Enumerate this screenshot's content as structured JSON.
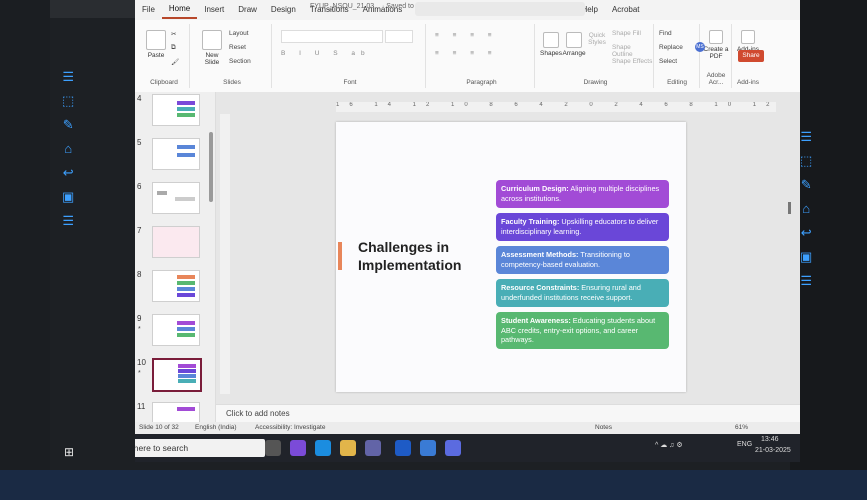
{
  "window": {
    "title": "FYUP_NSOU_21.03...",
    "save_status": "Saved to this PC"
  },
  "ribbon_tabs": [
    "File",
    "Home",
    "Insert",
    "Draw",
    "Design",
    "Transitions",
    "Animations",
    "Slide Show",
    "Record",
    "Review",
    "View",
    "Help",
    "Acrobat"
  ],
  "ribbon": {
    "clipboard": {
      "paste": "Paste",
      "label": "Clipboard"
    },
    "slides": {
      "new_slide": "New Slide",
      "layout": "Layout",
      "reset": "Reset",
      "section": "Section",
      "label": "Slides"
    },
    "font": {
      "label": "Font"
    },
    "paragraph": {
      "label": "Paragraph"
    },
    "drawing": {
      "shapes": "Shapes",
      "arrange": "Arrange",
      "quick_styles": "Quick Styles",
      "shape_fill": "Shape Fill",
      "shape_outline": "Shape Outline",
      "shape_effects": "Shape Effects",
      "label": "Drawing"
    },
    "editing": {
      "find": "Find",
      "replace": "Replace",
      "select": "Select",
      "label": "Editing"
    },
    "adobe": {
      "create_pdf": "Create a PDF",
      "label": "Adobe Acr..."
    },
    "addins": {
      "label": "Add-ins",
      "btn": "Add-ins"
    },
    "share": "Share",
    "avatar": "MS"
  },
  "thumbnails": [
    {
      "num": "4",
      "star": ""
    },
    {
      "num": "5",
      "star": ""
    },
    {
      "num": "6",
      "star": ""
    },
    {
      "num": "7",
      "star": ""
    },
    {
      "num": "8",
      "star": ""
    },
    {
      "num": "9",
      "star": "*"
    },
    {
      "num": "10",
      "star": "*"
    },
    {
      "num": "11",
      "star": ""
    }
  ],
  "slide": {
    "title_line1": "Challenges in",
    "title_line2": "Implementation",
    "cards": [
      {
        "head": "Curriculum Design:",
        "body": " Aligning multiple disciplines across institutions.",
        "color": "#a24bd6"
      },
      {
        "head": "Faculty Training:",
        "body": " Upskilling educators to deliver interdisciplinary learning.",
        "color": "#6a47d8"
      },
      {
        "head": "Assessment Methods:",
        "body": " Transitioning to competency-based evaluation.",
        "color": "#5a86d8"
      },
      {
        "head": "Resource Constraints:",
        "body": " Ensuring rural and underfunded institutions receive support.",
        "color": "#49aeb6"
      },
      {
        "head": "Student Awareness:",
        "body": " Educating students about ABC credits, entry-exit options, and career pathways.",
        "color": "#58b871"
      }
    ]
  },
  "ruler_text": "16 14 12 10 8 6 4 2 0 2 4 6 8 10 12 14 16",
  "notes_placeholder": "Click to add notes",
  "status": {
    "slide": "Slide 10 of 32",
    "language": "English (India)",
    "accessibility": "Accessibility: Investigate",
    "notes": "Notes",
    "zoom": "61%"
  },
  "taskbar": {
    "search_placeholder": "Type here to search",
    "time": "13:46",
    "date": "21-03-2025",
    "lang": "ENG"
  }
}
